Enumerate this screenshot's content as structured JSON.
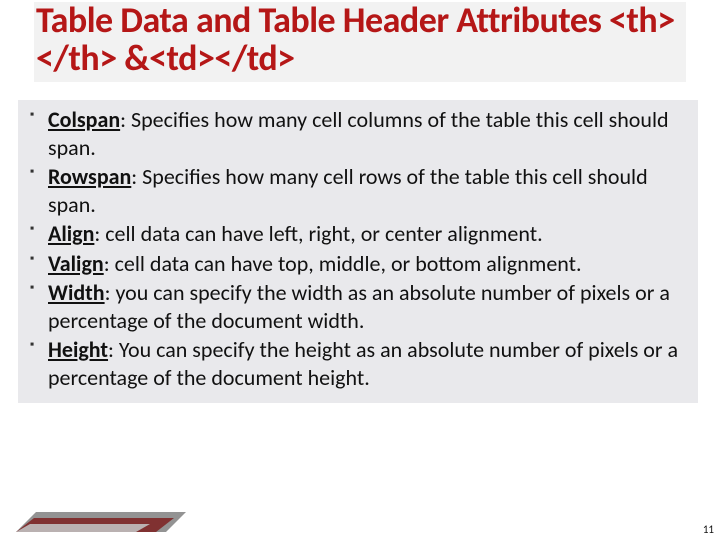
{
  "title": "Table Data and Table Header Attributes <th></th> &<td></td>",
  "bullets": [
    {
      "term": "Colspan",
      "sep": ": ",
      "desc": "Specifies how many cell columns of the table this cell should span."
    },
    {
      "term": "Rowspan",
      "sep": ": ",
      "desc": "Specifies how many cell rows of the table this cell should span."
    },
    {
      "term": "Align",
      "sep": ": ",
      "desc": "cell data can have left, right, or center alignment."
    },
    {
      "term": "Valign",
      "sep": ": ",
      "desc": "cell data can have top, middle, or bottom alignment."
    },
    {
      "term": "Width",
      "sep": ": ",
      "desc": "you can specify the width as an absolute number of pixels or a percentage of the document width."
    },
    {
      "term": "Height",
      "sep": ": ",
      "desc": "You can specify the height as an absolute number of pixels or a percentage of the document height."
    }
  ],
  "page_number": "11"
}
